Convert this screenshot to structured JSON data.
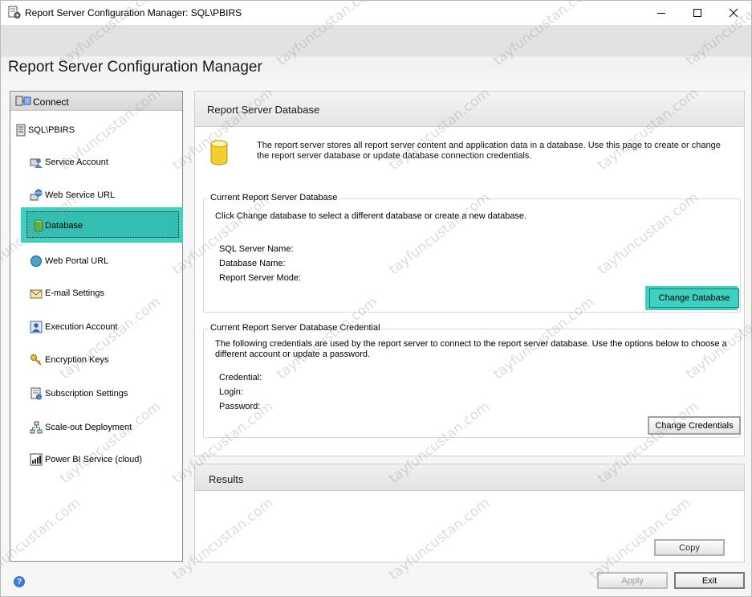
{
  "window": {
    "title": "Report Server Configuration Manager: SQL\\PBIRS",
    "header_title": "Report Server Configuration Manager"
  },
  "nav": {
    "connect_label": "Connect",
    "server_name": "SQL\\PBIRS",
    "items": [
      {
        "label": "Service Account",
        "icon": "service-account-icon"
      },
      {
        "label": "Web Service URL",
        "icon": "web-service-icon"
      },
      {
        "label": "Database",
        "icon": "database-icon",
        "active": true
      },
      {
        "label": "Web Portal URL",
        "icon": "globe-icon"
      },
      {
        "label": "E-mail Settings",
        "icon": "email-icon"
      },
      {
        "label": "Execution Account",
        "icon": "execution-account-icon"
      },
      {
        "label": "Encryption Keys",
        "icon": "key-icon"
      },
      {
        "label": "Subscription Settings",
        "icon": "subscription-icon"
      },
      {
        "label": "Scale-out Deployment",
        "icon": "scale-out-icon"
      },
      {
        "label": "Power BI Service (cloud)",
        "icon": "power-bi-icon"
      }
    ]
  },
  "panel": {
    "title": "Report Server Database",
    "intro": "The report server stores all report server content and application data in a database. Use this page to create or change the report server database or update database connection credentials.",
    "current_db": {
      "legend": "Current Report Server Database",
      "description": "Click Change database to select a different database or create a new database.",
      "fields": [
        "SQL Server Name:",
        "Database Name:",
        "Report Server Mode:"
      ],
      "button": "Change Database"
    },
    "credential": {
      "legend": "Current Report Server Database Credential",
      "description": "The following credentials are used by the report server to connect to the report server database.  Use the options below to choose a different account or update a password.",
      "fields": [
        "Credential:",
        "Login:",
        "Password:"
      ],
      "button": "Change Credentials"
    }
  },
  "results": {
    "title": "Results",
    "copy_button": "Copy"
  },
  "footer": {
    "help_glyph": "?",
    "apply_button": "Apply",
    "exit_button": "Exit"
  },
  "watermark": "tayfuncustan.com",
  "colors": {
    "highlight": "#3ed1c0"
  }
}
